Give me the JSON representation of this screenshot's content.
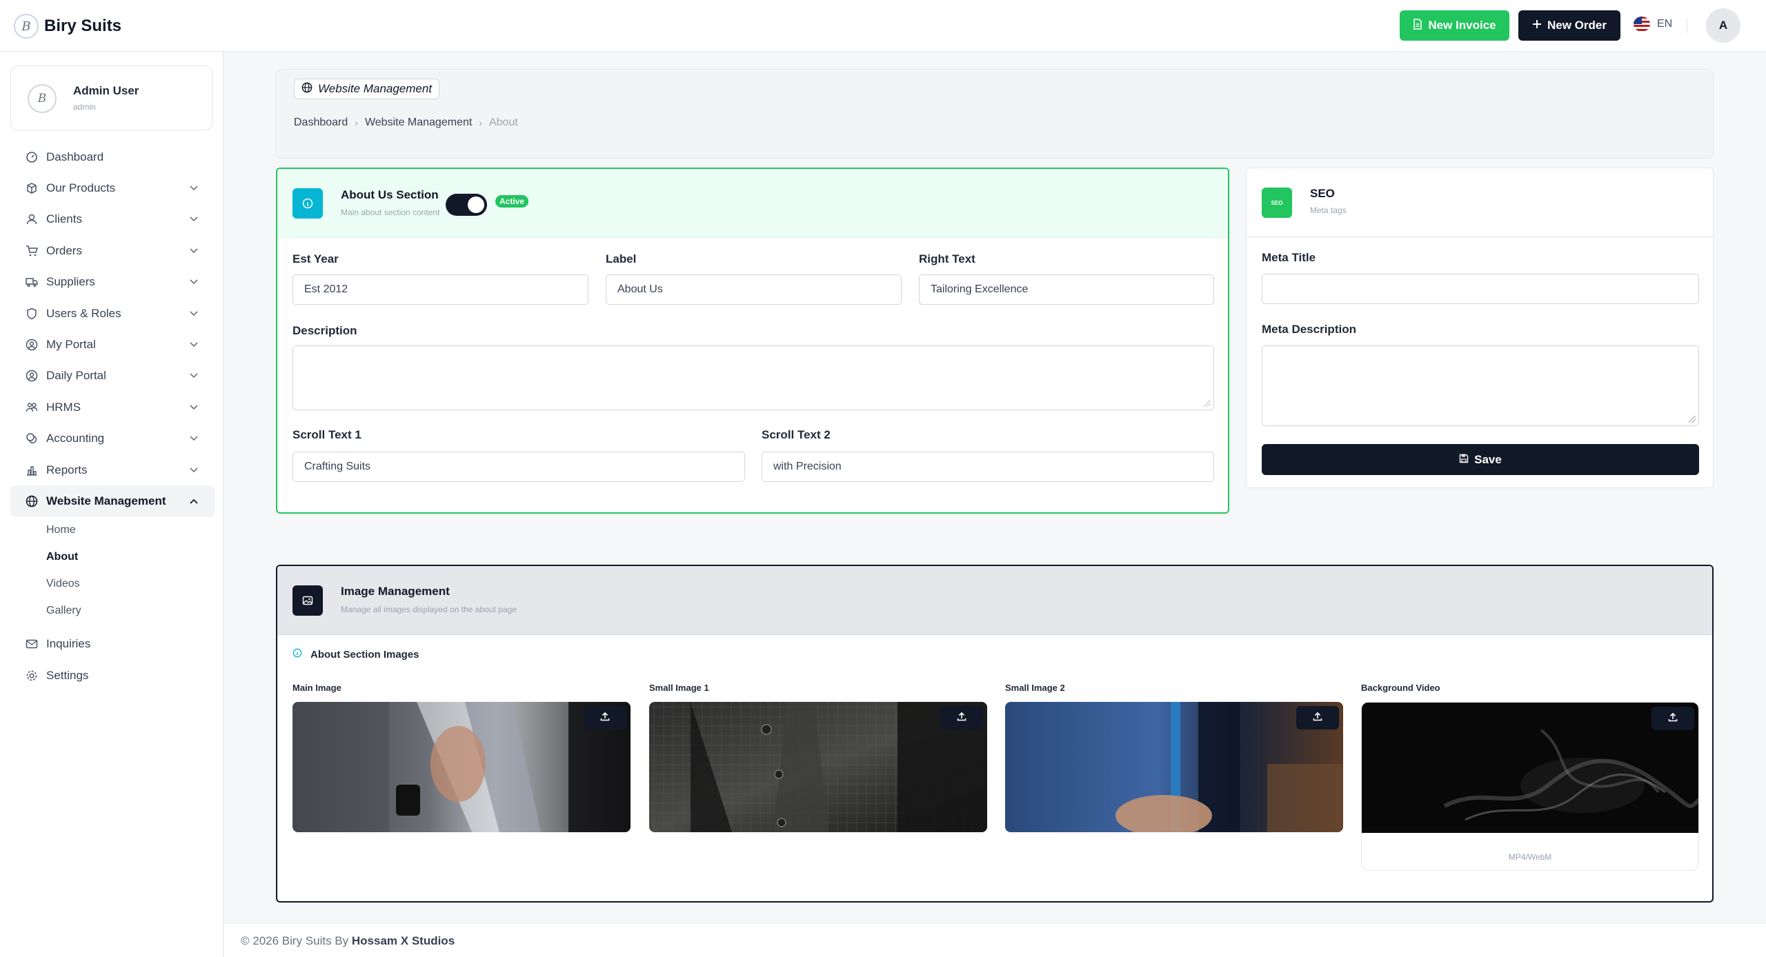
{
  "brand": {
    "name": "Biry Suits",
    "logo_letter": "B"
  },
  "topbar": {
    "new_invoice_label": "New Invoice",
    "new_order_label": "New Order",
    "language": "EN",
    "avatar_initial": "A"
  },
  "user": {
    "name": "Admin User",
    "role": "admin"
  },
  "sidebar": {
    "items": [
      {
        "label": "Dashboard",
        "icon": "dashboard-icon",
        "has_chevron": false
      },
      {
        "label": "Our Products",
        "icon": "box-icon",
        "has_chevron": true
      },
      {
        "label": "Clients",
        "icon": "user-icon",
        "has_chevron": true
      },
      {
        "label": "Orders",
        "icon": "cart-icon",
        "has_chevron": true
      },
      {
        "label": "Suppliers",
        "icon": "truck-icon",
        "has_chevron": true
      },
      {
        "label": "Users & Roles",
        "icon": "shield-icon",
        "has_chevron": true
      },
      {
        "label": "My Portal",
        "icon": "user-circle-icon",
        "has_chevron": true
      },
      {
        "label": "Daily Portal",
        "icon": "user-circle-icon",
        "has_chevron": true
      },
      {
        "label": "HRMS",
        "icon": "people-icon",
        "has_chevron": true
      },
      {
        "label": "Accounting",
        "icon": "coins-icon",
        "has_chevron": true
      },
      {
        "label": "Reports",
        "icon": "bar-chart-icon",
        "has_chevron": true
      },
      {
        "label": "Website Management",
        "icon": "globe-icon",
        "has_chevron": true,
        "expanded": true
      }
    ],
    "sub_items": [
      "Home",
      "About",
      "Videos",
      "Gallery"
    ],
    "current_sub": "About",
    "bottom_items": [
      {
        "label": "Inquiries",
        "icon": "mail-icon"
      },
      {
        "label": "Settings",
        "icon": "gear-icon"
      }
    ]
  },
  "page_header": {
    "pill_label": "Website Management",
    "breadcrumb": [
      "Dashboard",
      "Website Management",
      "About"
    ]
  },
  "about_section": {
    "title": "About Us Section",
    "subtitle": "Main about section content",
    "status_badge": "Active",
    "enabled": true,
    "fields": {
      "est_year": {
        "label": "Est Year",
        "value": "Est 2012"
      },
      "label": {
        "label": "Label",
        "value": "About Us"
      },
      "right_text": {
        "label": "Right Text",
        "value": "Tailoring Excellence"
      },
      "description": {
        "label": "Description",
        "value": ""
      },
      "scroll_text_1": {
        "label": "Scroll Text 1",
        "value": "Crafting Suits"
      },
      "scroll_text_2": {
        "label": "Scroll Text 2",
        "value": "with Precision"
      }
    }
  },
  "seo": {
    "title": "SEO",
    "subtitle": "Meta tags",
    "icon_text": "SEO",
    "meta_title": {
      "label": "Meta Title",
      "value": ""
    },
    "meta_description": {
      "label": "Meta Description",
      "value": ""
    },
    "save_label": "Save"
  },
  "image_management": {
    "title": "Image Management",
    "subtitle": "Manage all images displayed on the about page",
    "section_title": "About Section Images",
    "slots": [
      {
        "label": "Main Image",
        "kind": "image"
      },
      {
        "label": "Small Image 1",
        "kind": "image"
      },
      {
        "label": "Small Image 2",
        "kind": "image"
      },
      {
        "label": "Background Video",
        "kind": "video",
        "caption": "MP4/WebM"
      }
    ]
  },
  "footer": {
    "prefix": "© 2026 Biry Suits By",
    "studio": "Hossam X Studios"
  },
  "colors": {
    "accent_green": "#22c55e",
    "dark": "#111827",
    "teal": "#06b6d4"
  }
}
